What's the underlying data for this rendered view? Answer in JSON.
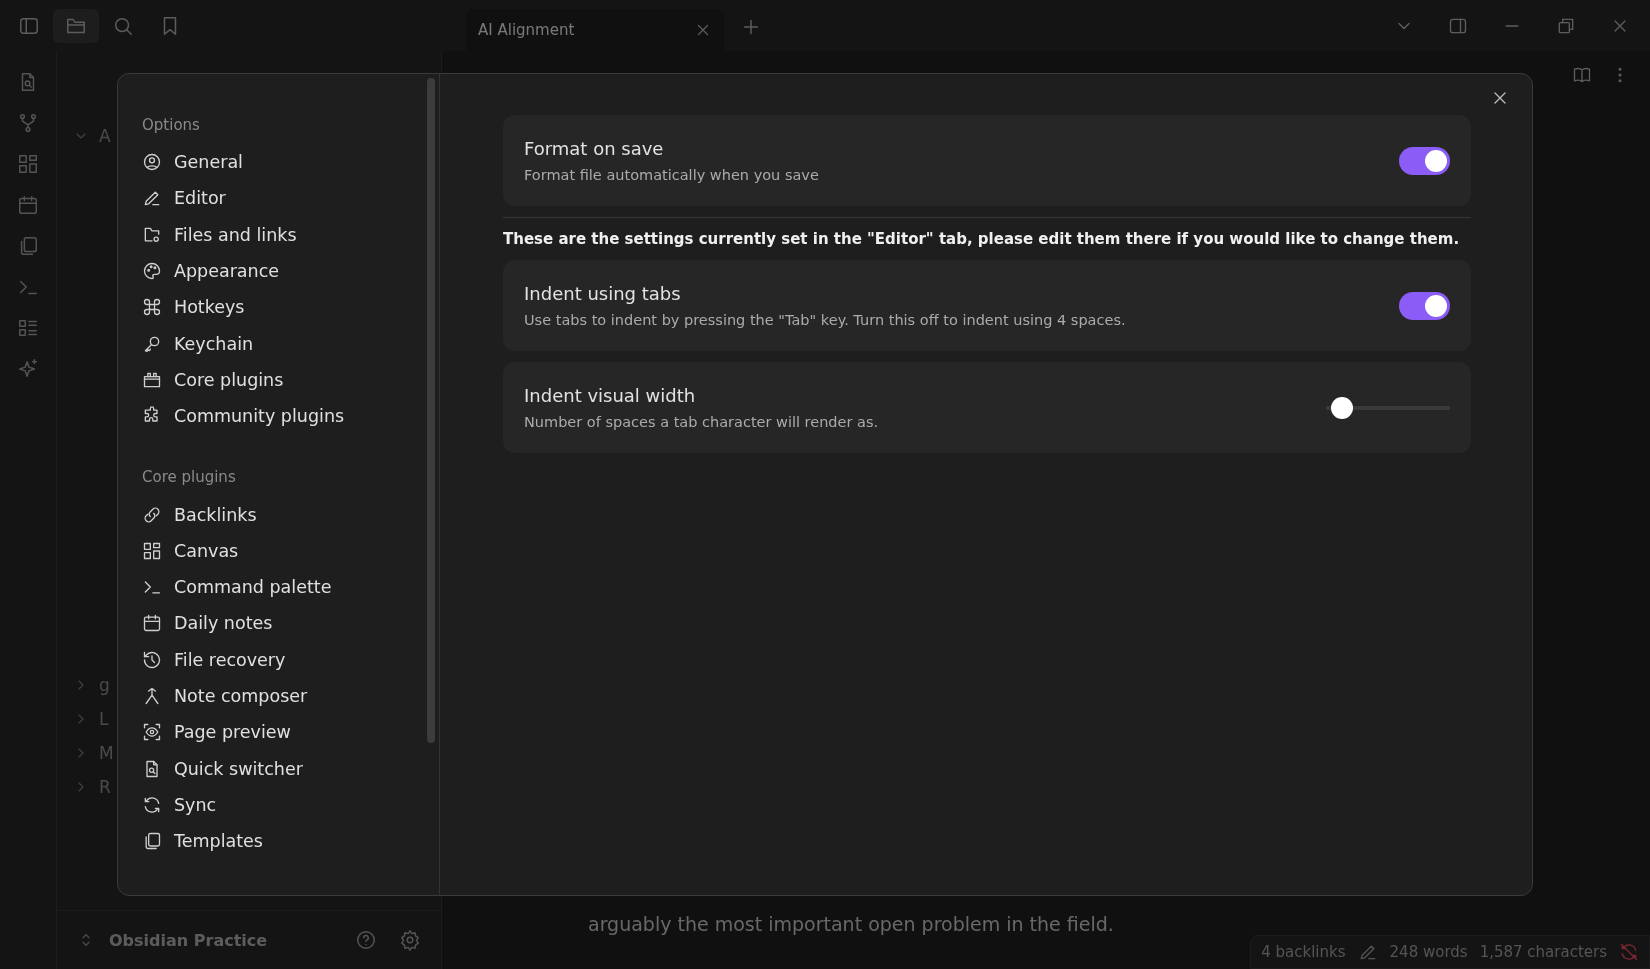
{
  "titlebar": {
    "tabs": [
      {
        "label": "AI Alignment",
        "selected": true
      }
    ]
  },
  "file_tree": {
    "items": [
      {
        "label": "A",
        "expanded": true
      },
      {
        "label": "g",
        "expanded": false
      },
      {
        "label": "L",
        "expanded": false
      },
      {
        "label": "M",
        "expanded": false
      },
      {
        "label": "R",
        "expanded": false
      }
    ]
  },
  "vault": {
    "name": "Obsidian Practice"
  },
  "editor": {
    "text": "arguably the most important open problem in the field."
  },
  "status_bar": {
    "backlinks": "4 backlinks",
    "words": "248 words",
    "characters": "1,587 characters"
  },
  "settings": {
    "sections": [
      {
        "heading": "Options",
        "items": [
          {
            "label": "General"
          },
          {
            "label": "Editor"
          },
          {
            "label": "Files and links"
          },
          {
            "label": "Appearance"
          },
          {
            "label": "Hotkeys"
          },
          {
            "label": "Keychain"
          },
          {
            "label": "Core plugins"
          },
          {
            "label": "Community plugins"
          }
        ]
      },
      {
        "heading": "Core plugins",
        "items": [
          {
            "label": "Backlinks"
          },
          {
            "label": "Canvas"
          },
          {
            "label": "Command palette"
          },
          {
            "label": "Daily notes"
          },
          {
            "label": "File recovery"
          },
          {
            "label": "Note composer"
          },
          {
            "label": "Page preview"
          },
          {
            "label": "Quick switcher"
          },
          {
            "label": "Sync"
          },
          {
            "label": "Templates"
          }
        ]
      }
    ],
    "options": [
      {
        "kind": "toggle",
        "name": "Format on save",
        "description": "Format file automatically when you save",
        "on": true
      },
      {
        "kind": "note",
        "text": "These are the settings currently set in the \"Editor\" tab, please edit them there if you would like to change them."
      },
      {
        "kind": "toggle",
        "name": "Indent using tabs",
        "description": "Use tabs to indent by pressing the \"Tab\" key. Turn this off to indent using 4 spaces.",
        "on": true
      },
      {
        "kind": "slider",
        "name": "Indent visual width",
        "description": "Number of spaces a tab character will render as.",
        "level": 0.05
      }
    ]
  }
}
